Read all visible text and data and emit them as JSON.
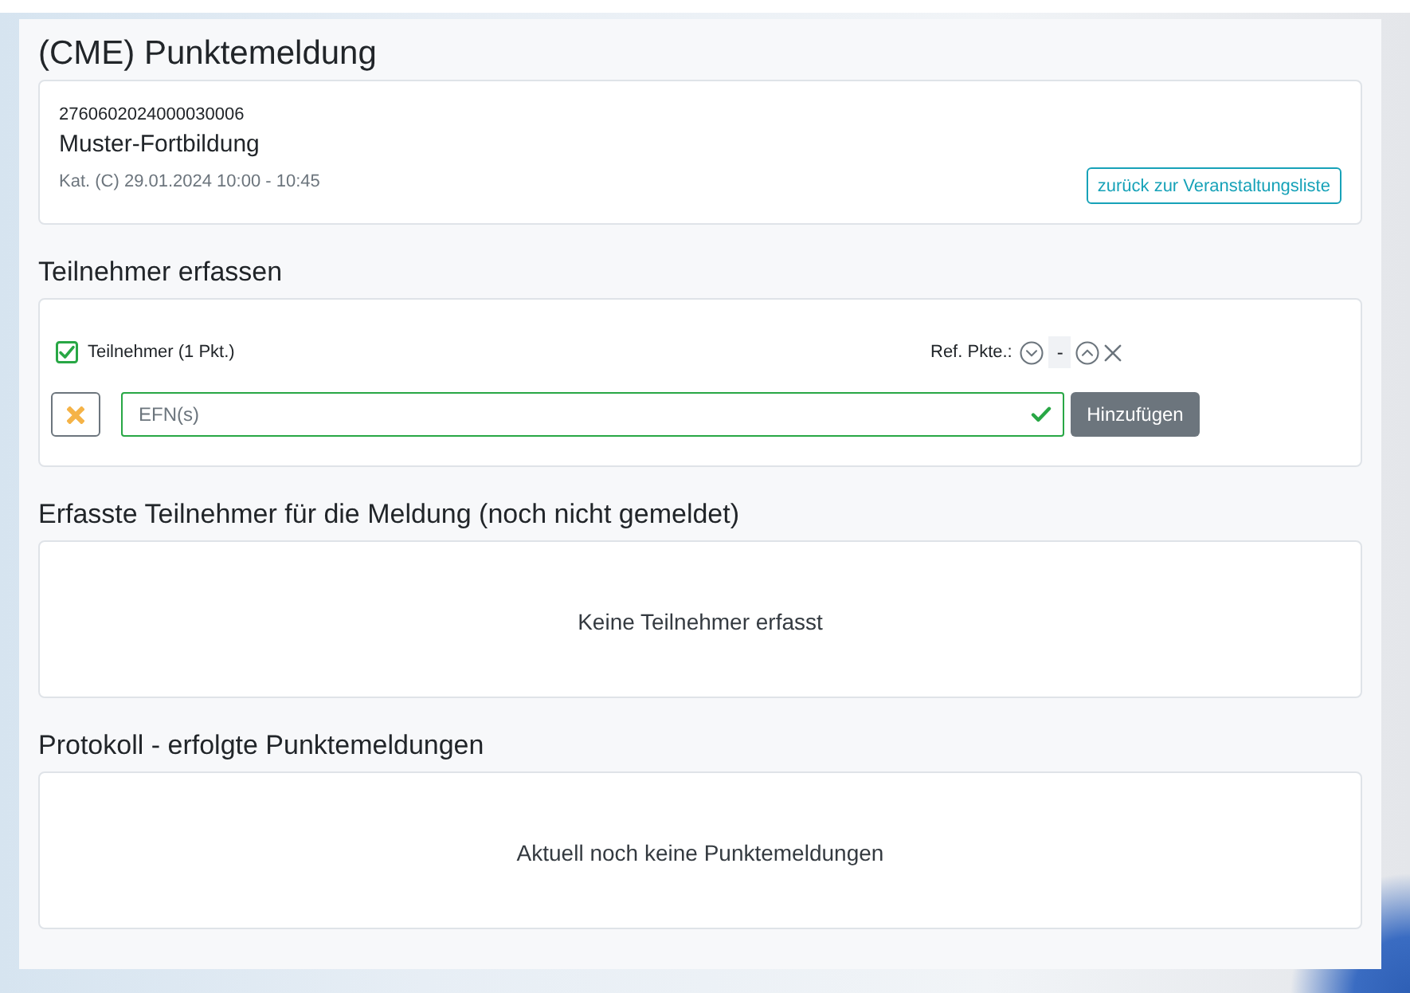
{
  "page": {
    "title": "(CME) Punktemeldung"
  },
  "event": {
    "number": "2760602024000030006",
    "name": "Muster-Fortbildung",
    "details": "Kat. (C) 29.01.2024 10:00 - 10:45",
    "back_button": "zurück zur Veranstaltungsliste"
  },
  "capture": {
    "heading": "Teilnehmer erfassen",
    "checkbox": {
      "label": "Teilnehmer (1 Pkt.)",
      "checked": true
    },
    "ref_points": {
      "label": "Ref. Pkte.:",
      "value": "-"
    },
    "efn_field": {
      "placeholder": "EFN(s)",
      "valid": true
    },
    "add_button": "Hinzufügen"
  },
  "sections": [
    {
      "heading": "Erfasste Teilnehmer für die Meldung (noch nicht gemeldet)",
      "empty_text": "Keine Teilnehmer erfasst"
    },
    {
      "heading": "Protokoll - erfolgte Punktemeldungen",
      "empty_text": "Aktuell noch keine Punktemeldungen"
    }
  ]
}
